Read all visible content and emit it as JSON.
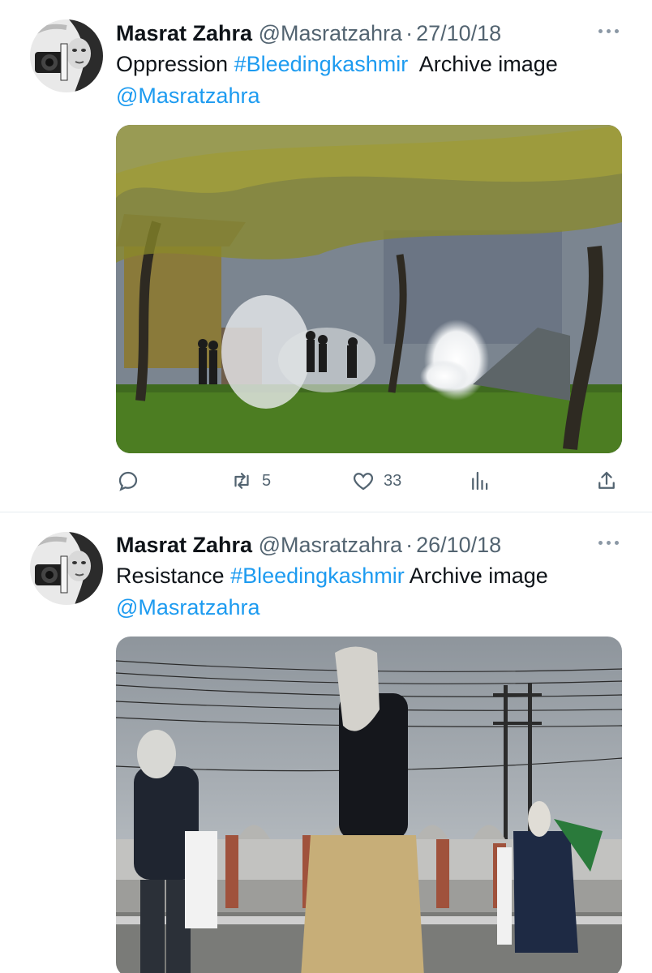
{
  "tweets": [
    {
      "name": "Masrat Zahra",
      "handle": "@Masratzahra",
      "separator": "·",
      "date": "27/10/18",
      "text_word": "Oppression",
      "hashtag": "#Bleedingkashmir",
      "text_rest": "Archive image",
      "mention": "@Masratzahra",
      "retweets": "5",
      "likes": "33"
    },
    {
      "name": "Masrat Zahra",
      "handle": "@Masratzahra",
      "separator": "·",
      "date": "26/10/18",
      "text_word": "Resistance",
      "hashtag": "#Bleedingkashmir",
      "text_rest": "Archive image",
      "mention": "@Masratzahra"
    }
  ],
  "icons": {
    "reply": "reply-icon",
    "retweet": "retweet-icon",
    "like": "heart-icon",
    "views": "analytics-icon",
    "share": "share-icon",
    "more": "more-icon"
  },
  "colors": {
    "link": "#1d9bf0",
    "secondary_text": "#536471",
    "divider": "#e6ecf0"
  }
}
